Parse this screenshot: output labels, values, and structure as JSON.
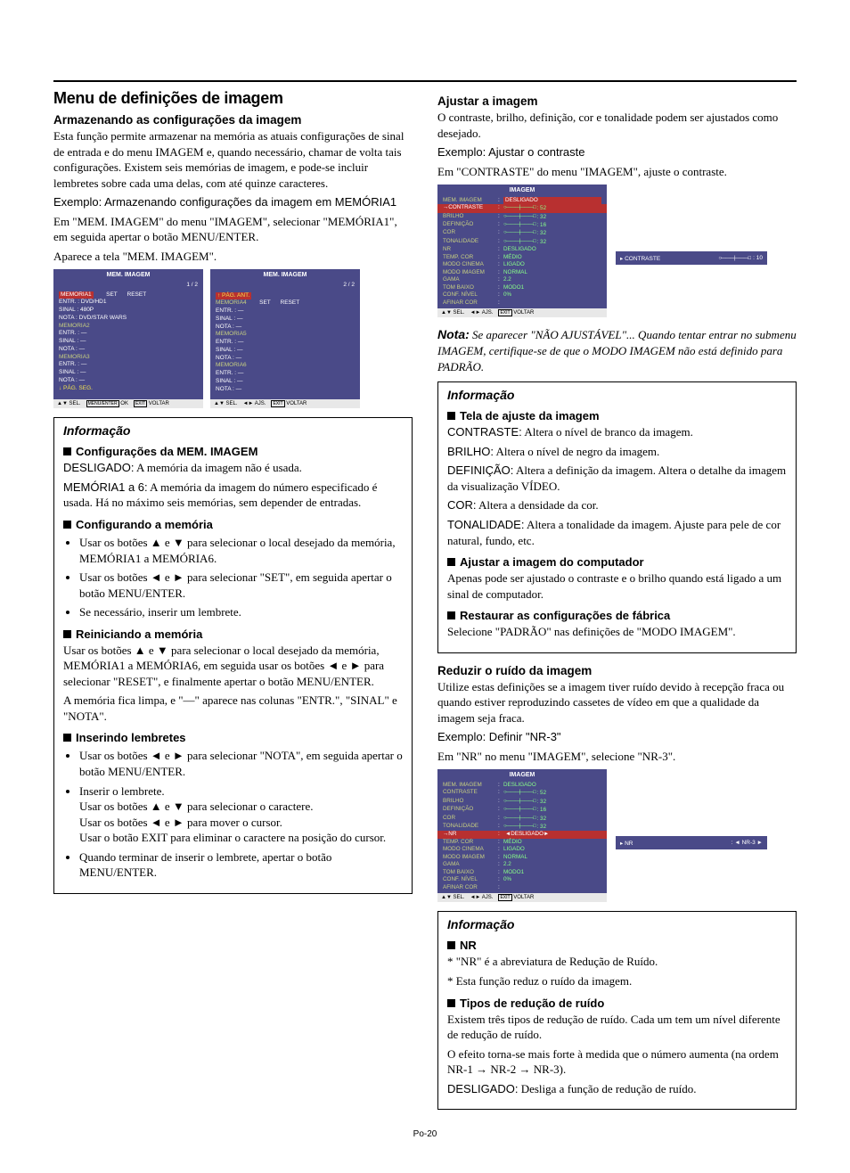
{
  "left": {
    "h1": "Menu de definições de imagem",
    "h2a": "Armazenando as configurações da imagem",
    "p1": "Esta função permite armazenar na memória as atuais configurações de sinal de entrada e do menu IMAGEM e, quando necessário, chamar de volta tais configurações. Existem seis memórias de imagem, e pode-se incluir lembretes sobre cada uma delas, com até quinze caracteres.",
    "p2": "Exemplo: Armazenando configurações da imagem em MEMÓRIA1",
    "p3a": "Em \"MEM. IMAGEM\" do menu \"IMAGEM\", selecionar \"MEMÓRIA1\", em seguida apertar o botão MENU/ENTER.",
    "p3b": "Aparece a tela \"MEM. IMAGEM\".",
    "osd1": {
      "title": "MEM. IMAGEM",
      "page": "1 / 2",
      "mem1": "MEMORIA1",
      "set": "SET",
      "reset": "RESET",
      "l1": "ENTR. : DVD/HD1",
      "l2": "SINAL : 480P",
      "l3": "NOTA : DVD/STAR WARS",
      "mem2": "MEMORIA2",
      "mem3": "MEMORIA3",
      "blank_e": "ENTR. : —",
      "blank_s": "SINAL : —",
      "blank_n": "NOTA : —",
      "pgseg": "↓ PÁG. SEG.",
      "foot_sel": "▲▼ SEL.",
      "foot_ok": "OK",
      "foot_menu": "MENU/ENTER",
      "foot_back": "VOLTAR",
      "foot_exit": "EXIT"
    },
    "osd2": {
      "title": "MEM. IMAGEM",
      "page": "2 / 2",
      "pgant": "↑ PÁG. ANT.",
      "mem4": "MEMORIA4",
      "mem5": "MEMORIA5",
      "mem6": "MEMORIA6",
      "set": "SET",
      "reset": "RESET",
      "blank_e": "ENTR. : —",
      "blank_s": "SINAL : —",
      "blank_n": "NOTA : —",
      "foot_sel": "▲▼ SEL.",
      "foot_ajs": "◄► AJS.",
      "foot_back": "VOLTAR",
      "foot_exit": "EXIT"
    },
    "info": {
      "hdr": "Informação",
      "sec1": "Configurações da MEM. IMAGEM",
      "desl_lbl": "DESLIGADO:",
      "desl_txt": " A memória da imagem não é usada.",
      "mem_lbl": "MEMÓRIA1 a 6:",
      "mem_txt": " A memória da imagem do número especificado é usada. Há no máximo seis memórias, sem depender de entradas.",
      "sec2": "Configurando a memória",
      "b1": "Usar os botões ▲ e ▼ para selecionar o local desejado da memória, MEMÓRIA1 a MEMÓRIA6.",
      "b2": "Usar os botões ◄ e ► para selecionar \"SET\", em seguida apertar o botão MENU/ENTER.",
      "b3": "Se necessário, inserir um lembrete.",
      "sec3": "Reiniciando a memória",
      "r1": "Usar os botões ▲ e ▼ para selecionar o local desejado da memória, MEMÓRIA1 a MEMÓRIA6, em seguida usar os botões ◄ e ► para selecionar \"RESET\", e finalmente apertar o botão MENU/ENTER.",
      "r2": "A memória fica limpa, e \"—\" aparece nas colunas \"ENTR.\", \"SINAL\" e \"NOTA\".",
      "sec4": "Inserindo lembretes",
      "i1": "Usar os botões ◄ e ► para selecionar \"NOTA\", em seguida apertar o botão MENU/ENTER.",
      "i2a": "Inserir o lembrete.",
      "i2b": "Usar os botões ▲ e ▼ para selecionar o caractere.",
      "i2c": "Usar os botões ◄ e ► para mover o cursor.",
      "i2d": "Usar o botão EXIT para eliminar o caractere na posição do cursor.",
      "i3": "Quando terminar de inserir o lembrete, apertar o botão MENU/ENTER."
    }
  },
  "right": {
    "h2a": "Ajustar a imagem",
    "p1": "O contraste, brilho, definição, cor e tonalidade podem ser ajustados como desejado.",
    "p2": "Exemplo: Ajustar o contraste",
    "p3": "Em \"CONTRASTE\" do menu \"IMAGEM\", ajuste o contraste.",
    "osd_img": {
      "title": "IMAGEM",
      "rows": [
        {
          "k": "MEM. IMAGEM",
          "v": "DESLIGADO",
          "hl": true,
          "slider": false
        },
        {
          "k": "→CONTRASTE",
          "v": ": 52",
          "slider": true,
          "sel": true
        },
        {
          "k": "BRILHO",
          "v": ": 32",
          "slider": true
        },
        {
          "k": "DEFINIÇÃO",
          "v": ": 16",
          "slider": true
        },
        {
          "k": "COR",
          "v": ": 32",
          "slider": true
        },
        {
          "k": "TONALIDADE",
          "v": ": 32",
          "slider": true
        },
        {
          "k": "NR",
          "v": "DESLIGADO"
        },
        {
          "k": "TEMP. COR",
          "v": "MÉDIO"
        },
        {
          "k": "MODO CINEMA",
          "v": "LIGADO"
        },
        {
          "k": "MODO IMAGEM",
          "v": "NORMAL"
        },
        {
          "k": "GAMA",
          "v": "2.2"
        },
        {
          "k": "TOM BAIXO",
          "v": "MODO1"
        },
        {
          "k": "CONF. NÍVEL",
          "v": "0%"
        },
        {
          "k": "AFINAR COR",
          "v": ""
        }
      ],
      "foot_sel": "▲▼ SEL.",
      "foot_ajs": "◄► AJS.",
      "foot_back": "VOLTAR",
      "foot_exit": "EXIT",
      "mini_k": "▸ CONTRASTE",
      "mini_v": ": 10"
    },
    "note_lbl": "Nota:",
    "note_txt": " Se aparecer \"NÃO AJUSTÁVEL\"... Quando tentar entrar no submenu IMAGEM, certifique-se de que o MODO IMAGEM não está definido para PADRÃO.",
    "info1": {
      "hdr": "Informação",
      "sec1": "Tela de ajuste da imagem",
      "l1a": "CONTRASTE:",
      "l1b": " Altera o nível de branco da imagem.",
      "l2a": "BRILHO:",
      "l2b": " Altera o nível de negro da imagem.",
      "l3a": "DEFINIÇÃO:",
      "l3b": " Altera a definição da imagem. Altera o detalhe da imagem da visualização VÍDEO.",
      "l4a": "COR:",
      "l4b": " Altera a densidade da cor.",
      "l5a": "TONALIDADE:",
      "l5b": " Altera a tonalidade da imagem. Ajuste para pele de cor natural, fundo, etc.",
      "sec2": "Ajustar a imagem do computador",
      "pc": "Apenas pode ser ajustado o contraste e o brilho quando está ligado a um sinal de computador.",
      "sec3": "Restaurar as configurações de fábrica",
      "rf": "Selecione \"PADRÃO\" nas definições de \"MODO IMAGEM\"."
    },
    "h2b": "Reduzir o ruído da imagem",
    "rp1": "Utilize estas definições se a imagem tiver ruído devido à recepção fraca ou quando estiver reproduzindo cassetes de vídeo em que a qualidade da imagem seja fraca.",
    "rp2": "Exemplo: Definir \"NR-3\"",
    "rp3": "Em \"NR\" no menu \"IMAGEM\", selecione \"NR-3\".",
    "osd_nr": {
      "title": "IMAGEM",
      "rows": [
        {
          "k": "MEM. IMAGEM",
          "v": "DESLIGADO"
        },
        {
          "k": "CONTRASTE",
          "v": ": 52",
          "slider": true
        },
        {
          "k": "BRILHO",
          "v": ": 32",
          "slider": true
        },
        {
          "k": "DEFINIÇÃO",
          "v": ": 16",
          "slider": true
        },
        {
          "k": "COR",
          "v": ": 32",
          "slider": true
        },
        {
          "k": "TONALIDADE",
          "v": ": 32",
          "slider": true
        },
        {
          "k": "→NR",
          "v": "◄DESLIGADO►",
          "hl": true,
          "sel": true
        },
        {
          "k": "TEMP. COR",
          "v": "MÉDIO"
        },
        {
          "k": "MODO CINEMA",
          "v": "LIGADO"
        },
        {
          "k": "MODO IMAGEM",
          "v": "NORMAL"
        },
        {
          "k": "GAMA",
          "v": "2.2"
        },
        {
          "k": "TOM BAIXO",
          "v": "MODO1"
        },
        {
          "k": "CONF. NÍVEL",
          "v": "0%"
        },
        {
          "k": "AFINAR COR",
          "v": ""
        }
      ],
      "foot_sel": "▲▼ SEL.",
      "foot_ajs": "◄► AJS.",
      "foot_back": "VOLTAR",
      "foot_exit": "EXIT",
      "mini_k": "▸ NR",
      "mini_v": ": ◄ NR-3 ►"
    },
    "info2": {
      "hdr": "Informação",
      "sec1": "NR",
      "n1": "* \"NR\" é a abreviatura de Redução de Ruído.",
      "n2": "* Esta função reduz o ruído da imagem.",
      "sec2": "Tipos de redução de ruído",
      "t1": "Existem três tipos de redução de ruído. Cada um tem um nível diferente de redução de ruído.",
      "t2": "O efeito torna-se mais forte à medida que o número aumenta (na ordem NR-1 → NR-2 → NR-3).",
      "t3a": "DESLIGADO:",
      "t3b": " Desliga a função de redução de ruído."
    }
  },
  "pagenum": "Po-20"
}
